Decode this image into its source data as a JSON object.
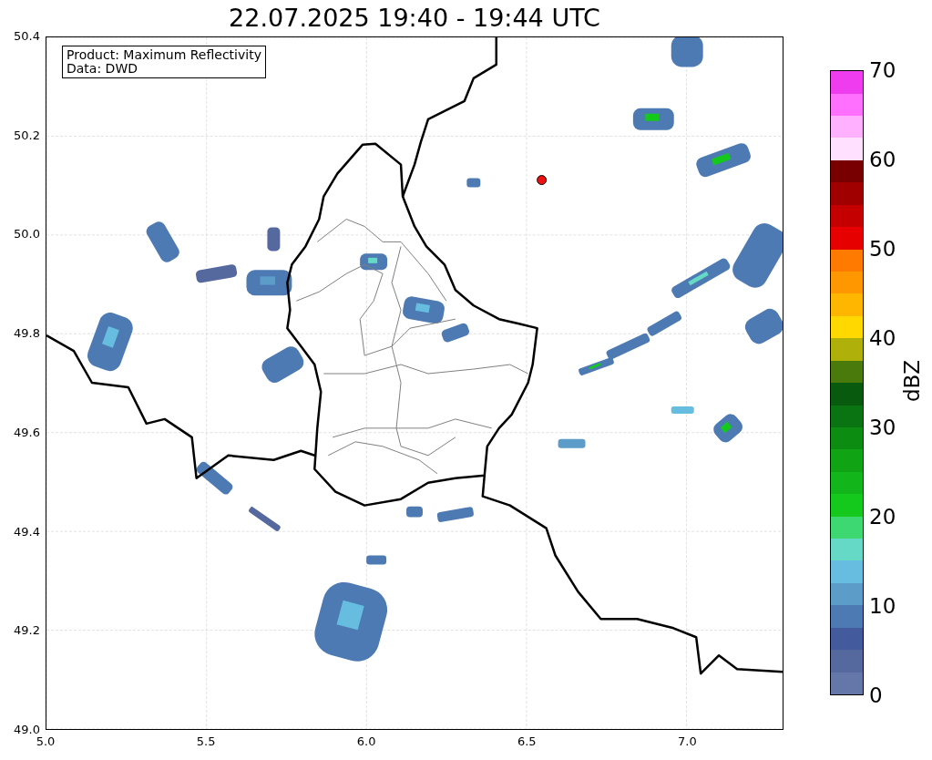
{
  "title": "22.07.2025 19:40 - 19:44 UTC",
  "map": {
    "annotation": [
      "Product: Maximum Reflectivity",
      "Data: DWD"
    ],
    "xticks": [
      "5.0",
      "5.5",
      "6.0",
      "6.5",
      "7.0"
    ],
    "yticks": [
      "50.4",
      "50.2",
      "50.0",
      "49.8",
      "49.6",
      "49.4",
      "49.2",
      "49.0"
    ]
  },
  "colorbar": {
    "label": "dBZ",
    "ticks": [
      "70",
      "60",
      "50",
      "40",
      "30",
      "20",
      "10",
      "0"
    ],
    "segments": [
      {
        "color": "#6577a8"
      },
      {
        "color": "#55699f"
      },
      {
        "color": "#435a9c"
      },
      {
        "color": "#4d7ab2"
      },
      {
        "color": "#5b9dc8"
      },
      {
        "color": "#66bde0"
      },
      {
        "color": "#66d9c6"
      },
      {
        "color": "#3ed872"
      },
      {
        "color": "#14c81c"
      },
      {
        "color": "#12b51a"
      },
      {
        "color": "#10a314"
      },
      {
        "color": "#0c8c10"
      },
      {
        "color": "#0a7412"
      },
      {
        "color": "#085a0e"
      },
      {
        "color": "#4a7a0c"
      },
      {
        "color": "#b0b00a"
      },
      {
        "color": "#ffd800"
      },
      {
        "color": "#ffb600"
      },
      {
        "color": "#ff9800"
      },
      {
        "color": "#ff7a00"
      },
      {
        "color": "#e60000"
      },
      {
        "color": "#c40000"
      },
      {
        "color": "#a00000"
      },
      {
        "color": "#780000"
      },
      {
        "color": "#ffe0ff"
      },
      {
        "color": "#ffb0ff"
      },
      {
        "color": "#ff70ff"
      },
      {
        "color": "#ee3cee"
      }
    ]
  }
}
